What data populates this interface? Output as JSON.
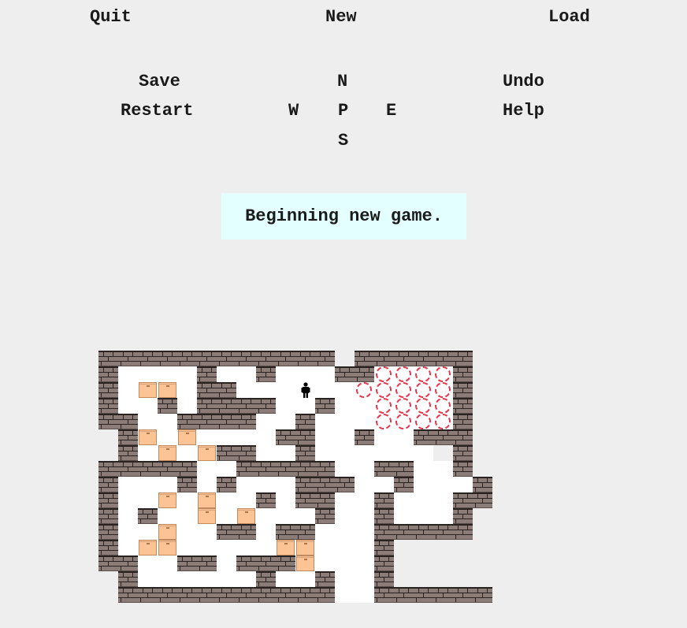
{
  "menu": {
    "quit": "Quit",
    "new": "New",
    "load": "Load",
    "save": "Save",
    "undo": "Undo",
    "restart": "Restart",
    "help": "Help"
  },
  "dirs": {
    "north": "N",
    "south": "S",
    "west": "W",
    "east": "E",
    "player": "P"
  },
  "status": "Beginning new game.",
  "board": {
    "colors": {
      "wall": "#8c7c78",
      "box": "#fcc495",
      "goal": "#e8364c",
      "floor": "#ffffff"
    },
    "legend": {
      "#": "wall",
      "$": "box",
      ".": "goal",
      "@": "player",
      " ": "floor",
      "_": "outside"
    },
    "rows": [
      "############_######",
      "#    #  #   ##....#",
      "# $$ ##      .....#",
      "#  # ####  #  ....#",
      "##  ####  #   ....#",
      "_#$ $    ##  #  ###",
      "_# $ $##  #      _#",
      "#####  #####  ##  #",
      "#   # #   ###  #   #",
      "#  $ $  # ##  #   ##",
      "# #  $ $   #  #   #_",
      "#  $  ## ##   #####_",
      "# $$     $$   #_____",
      "##  ## ###$   #_____",
      "_#      #  #  #_____",
      "_###########  ######"
    ],
    "player_row": 2,
    "player_col": 10
  }
}
